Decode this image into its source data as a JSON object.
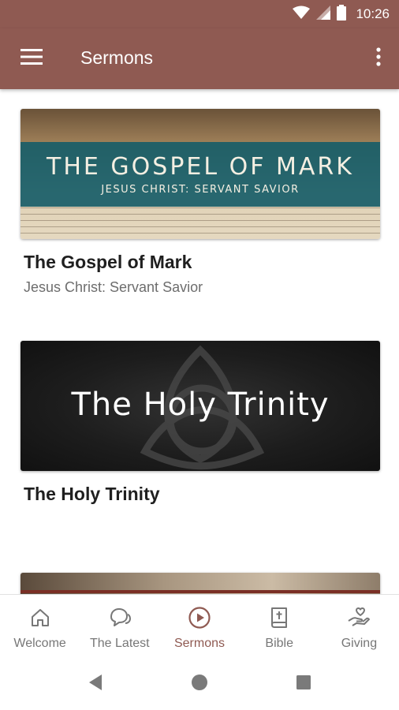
{
  "status": {
    "time": "10:26"
  },
  "appbar": {
    "title": "Sermons",
    "menu_icon": "hamburger-menu-icon",
    "more_icon": "more-vert-icon"
  },
  "sermons": [
    {
      "title": "The Gospel of Mark",
      "subtitle": "Jesus Christ: Servant Savior",
      "banner_title": "THE GOSPEL OF MARK",
      "banner_subtitle": "JESUS CHRIST: SERVANT SAVIOR"
    },
    {
      "title": "The Holy Trinity",
      "subtitle": "",
      "banner_title": "The Holy Trinity"
    }
  ],
  "bottom_nav": {
    "active": "Sermons",
    "items": [
      {
        "label": "Welcome",
        "icon": "home-icon"
      },
      {
        "label": "The Latest",
        "icon": "chat-bubbles-icon"
      },
      {
        "label": "Sermons",
        "icon": "play-circle-icon"
      },
      {
        "label": "Bible",
        "icon": "bible-icon"
      },
      {
        "label": "Giving",
        "icon": "giving-hand-icon"
      }
    ]
  },
  "colors": {
    "brand": "#8f5a52",
    "active_nav": "#8f5a52",
    "inactive_nav": "#777777"
  }
}
